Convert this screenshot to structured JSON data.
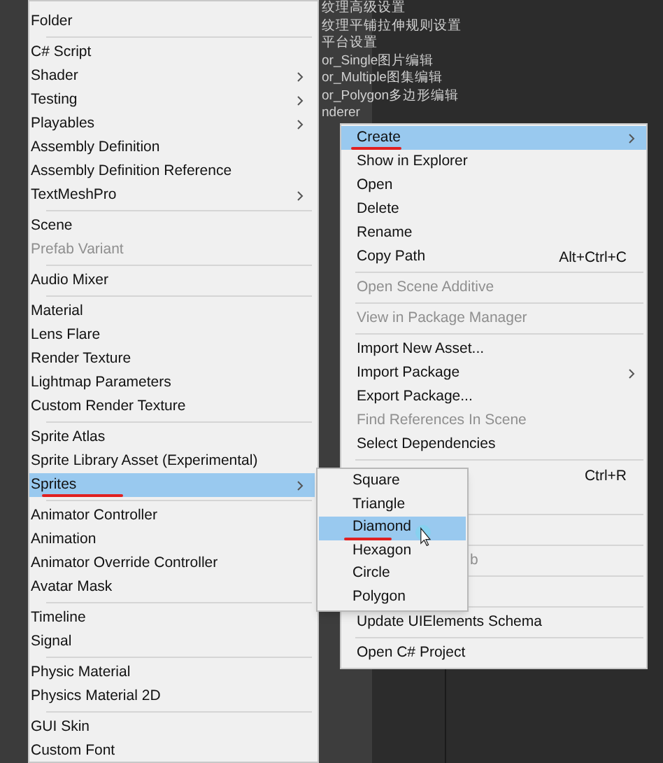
{
  "background_tree": {
    "items": [
      "纹理高级设置",
      "纹理平铺拉伸规则设置",
      "平台设置",
      "or_Single图片编辑",
      "or_Multiple图集编辑",
      "or_Polygon多边形编辑",
      "nderer"
    ]
  },
  "create_menu": {
    "items": [
      {
        "kind": "item",
        "label": "Folder",
        "selected": false,
        "disabled": false,
        "arrow": false,
        "marked": false
      },
      {
        "kind": "separator"
      },
      {
        "kind": "item",
        "label": "C# Script",
        "selected": false,
        "disabled": false,
        "arrow": false,
        "marked": false
      },
      {
        "kind": "item",
        "label": "Shader",
        "selected": false,
        "disabled": false,
        "arrow": true,
        "marked": false
      },
      {
        "kind": "item",
        "label": "Testing",
        "selected": false,
        "disabled": false,
        "arrow": true,
        "marked": false
      },
      {
        "kind": "item",
        "label": "Playables",
        "selected": false,
        "disabled": false,
        "arrow": true,
        "marked": false
      },
      {
        "kind": "item",
        "label": "Assembly Definition",
        "selected": false,
        "disabled": false,
        "arrow": false,
        "marked": false
      },
      {
        "kind": "item",
        "label": "Assembly Definition Reference",
        "selected": false,
        "disabled": false,
        "arrow": false,
        "marked": false
      },
      {
        "kind": "item",
        "label": "TextMeshPro",
        "selected": false,
        "disabled": false,
        "arrow": true,
        "marked": false
      },
      {
        "kind": "separator"
      },
      {
        "kind": "item",
        "label": "Scene",
        "selected": false,
        "disabled": false,
        "arrow": false,
        "marked": false
      },
      {
        "kind": "item",
        "label": "Prefab Variant",
        "selected": false,
        "disabled": true,
        "arrow": false,
        "marked": false
      },
      {
        "kind": "separator"
      },
      {
        "kind": "item",
        "label": "Audio Mixer",
        "selected": false,
        "disabled": false,
        "arrow": false,
        "marked": false
      },
      {
        "kind": "separator"
      },
      {
        "kind": "item",
        "label": "Material",
        "selected": false,
        "disabled": false,
        "arrow": false,
        "marked": false
      },
      {
        "kind": "item",
        "label": "Lens Flare",
        "selected": false,
        "disabled": false,
        "arrow": false,
        "marked": false
      },
      {
        "kind": "item",
        "label": "Render Texture",
        "selected": false,
        "disabled": false,
        "arrow": false,
        "marked": false
      },
      {
        "kind": "item",
        "label": "Lightmap Parameters",
        "selected": false,
        "disabled": false,
        "arrow": false,
        "marked": false
      },
      {
        "kind": "item",
        "label": "Custom Render Texture",
        "selected": false,
        "disabled": false,
        "arrow": false,
        "marked": false
      },
      {
        "kind": "separator"
      },
      {
        "kind": "item",
        "label": "Sprite Atlas",
        "selected": false,
        "disabled": false,
        "arrow": false,
        "marked": false
      },
      {
        "kind": "item",
        "label": "Sprite Library Asset (Experimental)",
        "selected": false,
        "disabled": false,
        "arrow": false,
        "marked": false
      },
      {
        "kind": "item",
        "label": "Sprites",
        "selected": true,
        "disabled": false,
        "arrow": true,
        "marked": true
      },
      {
        "kind": "separator"
      },
      {
        "kind": "item",
        "label": "Animator Controller",
        "selected": false,
        "disabled": false,
        "arrow": false,
        "marked": false
      },
      {
        "kind": "item",
        "label": "Animation",
        "selected": false,
        "disabled": false,
        "arrow": false,
        "marked": false
      },
      {
        "kind": "item",
        "label": "Animator Override Controller",
        "selected": false,
        "disabled": false,
        "arrow": false,
        "marked": false
      },
      {
        "kind": "item",
        "label": "Avatar Mask",
        "selected": false,
        "disabled": false,
        "arrow": false,
        "marked": false
      },
      {
        "kind": "separator"
      },
      {
        "kind": "item",
        "label": "Timeline",
        "selected": false,
        "disabled": false,
        "arrow": false,
        "marked": false
      },
      {
        "kind": "item",
        "label": "Signal",
        "selected": false,
        "disabled": false,
        "arrow": false,
        "marked": false
      },
      {
        "kind": "separator"
      },
      {
        "kind": "item",
        "label": "Physic Material",
        "selected": false,
        "disabled": false,
        "arrow": false,
        "marked": false
      },
      {
        "kind": "item",
        "label": "Physics Material 2D",
        "selected": false,
        "disabled": false,
        "arrow": false,
        "marked": false
      },
      {
        "kind": "separator"
      },
      {
        "kind": "item",
        "label": "GUI Skin",
        "selected": false,
        "disabled": false,
        "arrow": false,
        "marked": false
      },
      {
        "kind": "item",
        "label": "Custom Font",
        "selected": false,
        "disabled": false,
        "arrow": false,
        "marked": false
      }
    ]
  },
  "context_menu": {
    "items": [
      {
        "kind": "item",
        "label": "Create",
        "selected": true,
        "disabled": false,
        "arrow": true,
        "marked": true
      },
      {
        "kind": "item",
        "label": "Show in Explorer",
        "selected": false,
        "disabled": false,
        "arrow": false,
        "marked": false
      },
      {
        "kind": "item",
        "label": "Open",
        "selected": false,
        "disabled": false,
        "arrow": false,
        "marked": false
      },
      {
        "kind": "item",
        "label": "Delete",
        "selected": false,
        "disabled": false,
        "arrow": false,
        "marked": false
      },
      {
        "kind": "item",
        "label": "Rename",
        "selected": false,
        "disabled": false,
        "arrow": false,
        "marked": false
      },
      {
        "kind": "item",
        "label": "Copy Path",
        "shortcut": "Alt+Ctrl+C",
        "selected": false,
        "disabled": false,
        "arrow": false,
        "marked": false
      },
      {
        "kind": "separator"
      },
      {
        "kind": "item",
        "label": "Open Scene Additive",
        "selected": false,
        "disabled": true,
        "arrow": false,
        "marked": false
      },
      {
        "kind": "separator"
      },
      {
        "kind": "item",
        "label": "View in Package Manager",
        "selected": false,
        "disabled": true,
        "arrow": false,
        "marked": false
      },
      {
        "kind": "separator"
      },
      {
        "kind": "item",
        "label": "Import New Asset...",
        "selected": false,
        "disabled": false,
        "arrow": false,
        "marked": false
      },
      {
        "kind": "item",
        "label": "Import Package",
        "selected": false,
        "disabled": false,
        "arrow": true,
        "marked": false
      },
      {
        "kind": "item",
        "label": "Export Package...",
        "selected": false,
        "disabled": false,
        "arrow": false,
        "marked": false
      },
      {
        "kind": "item",
        "label": "Find References In Scene",
        "selected": false,
        "disabled": true,
        "arrow": false,
        "marked": false
      },
      {
        "kind": "item",
        "label": "Select Dependencies",
        "selected": false,
        "disabled": false,
        "arrow": false,
        "marked": false
      },
      {
        "kind": "separator"
      },
      {
        "kind": "covered",
        "shortcut": "Ctrl+R"
      },
      {
        "kind": "covered"
      },
      {
        "kind": "separator"
      },
      {
        "kind": "covered"
      },
      {
        "kind": "separator"
      },
      {
        "kind": "fragment",
        "label": "b",
        "disabled": true
      },
      {
        "kind": "separator"
      },
      {
        "kind": "covered"
      },
      {
        "kind": "separator"
      },
      {
        "kind": "item",
        "label": "Update UIElements Schema",
        "selected": false,
        "disabled": false,
        "arrow": false,
        "marked": false
      },
      {
        "kind": "separator"
      },
      {
        "kind": "item",
        "label": "Open C# Project",
        "selected": false,
        "disabled": false,
        "arrow": false,
        "marked": false
      }
    ]
  },
  "sprites_submenu": {
    "items": [
      {
        "label": "Square",
        "selected": false,
        "marked": false
      },
      {
        "label": "Triangle",
        "selected": false,
        "marked": false
      },
      {
        "label": "Diamond",
        "selected": true,
        "marked": true
      },
      {
        "label": "Hexagon",
        "selected": false,
        "marked": false
      },
      {
        "label": "Circle",
        "selected": false,
        "marked": false
      },
      {
        "label": "Polygon",
        "selected": false,
        "marked": false
      }
    ]
  }
}
